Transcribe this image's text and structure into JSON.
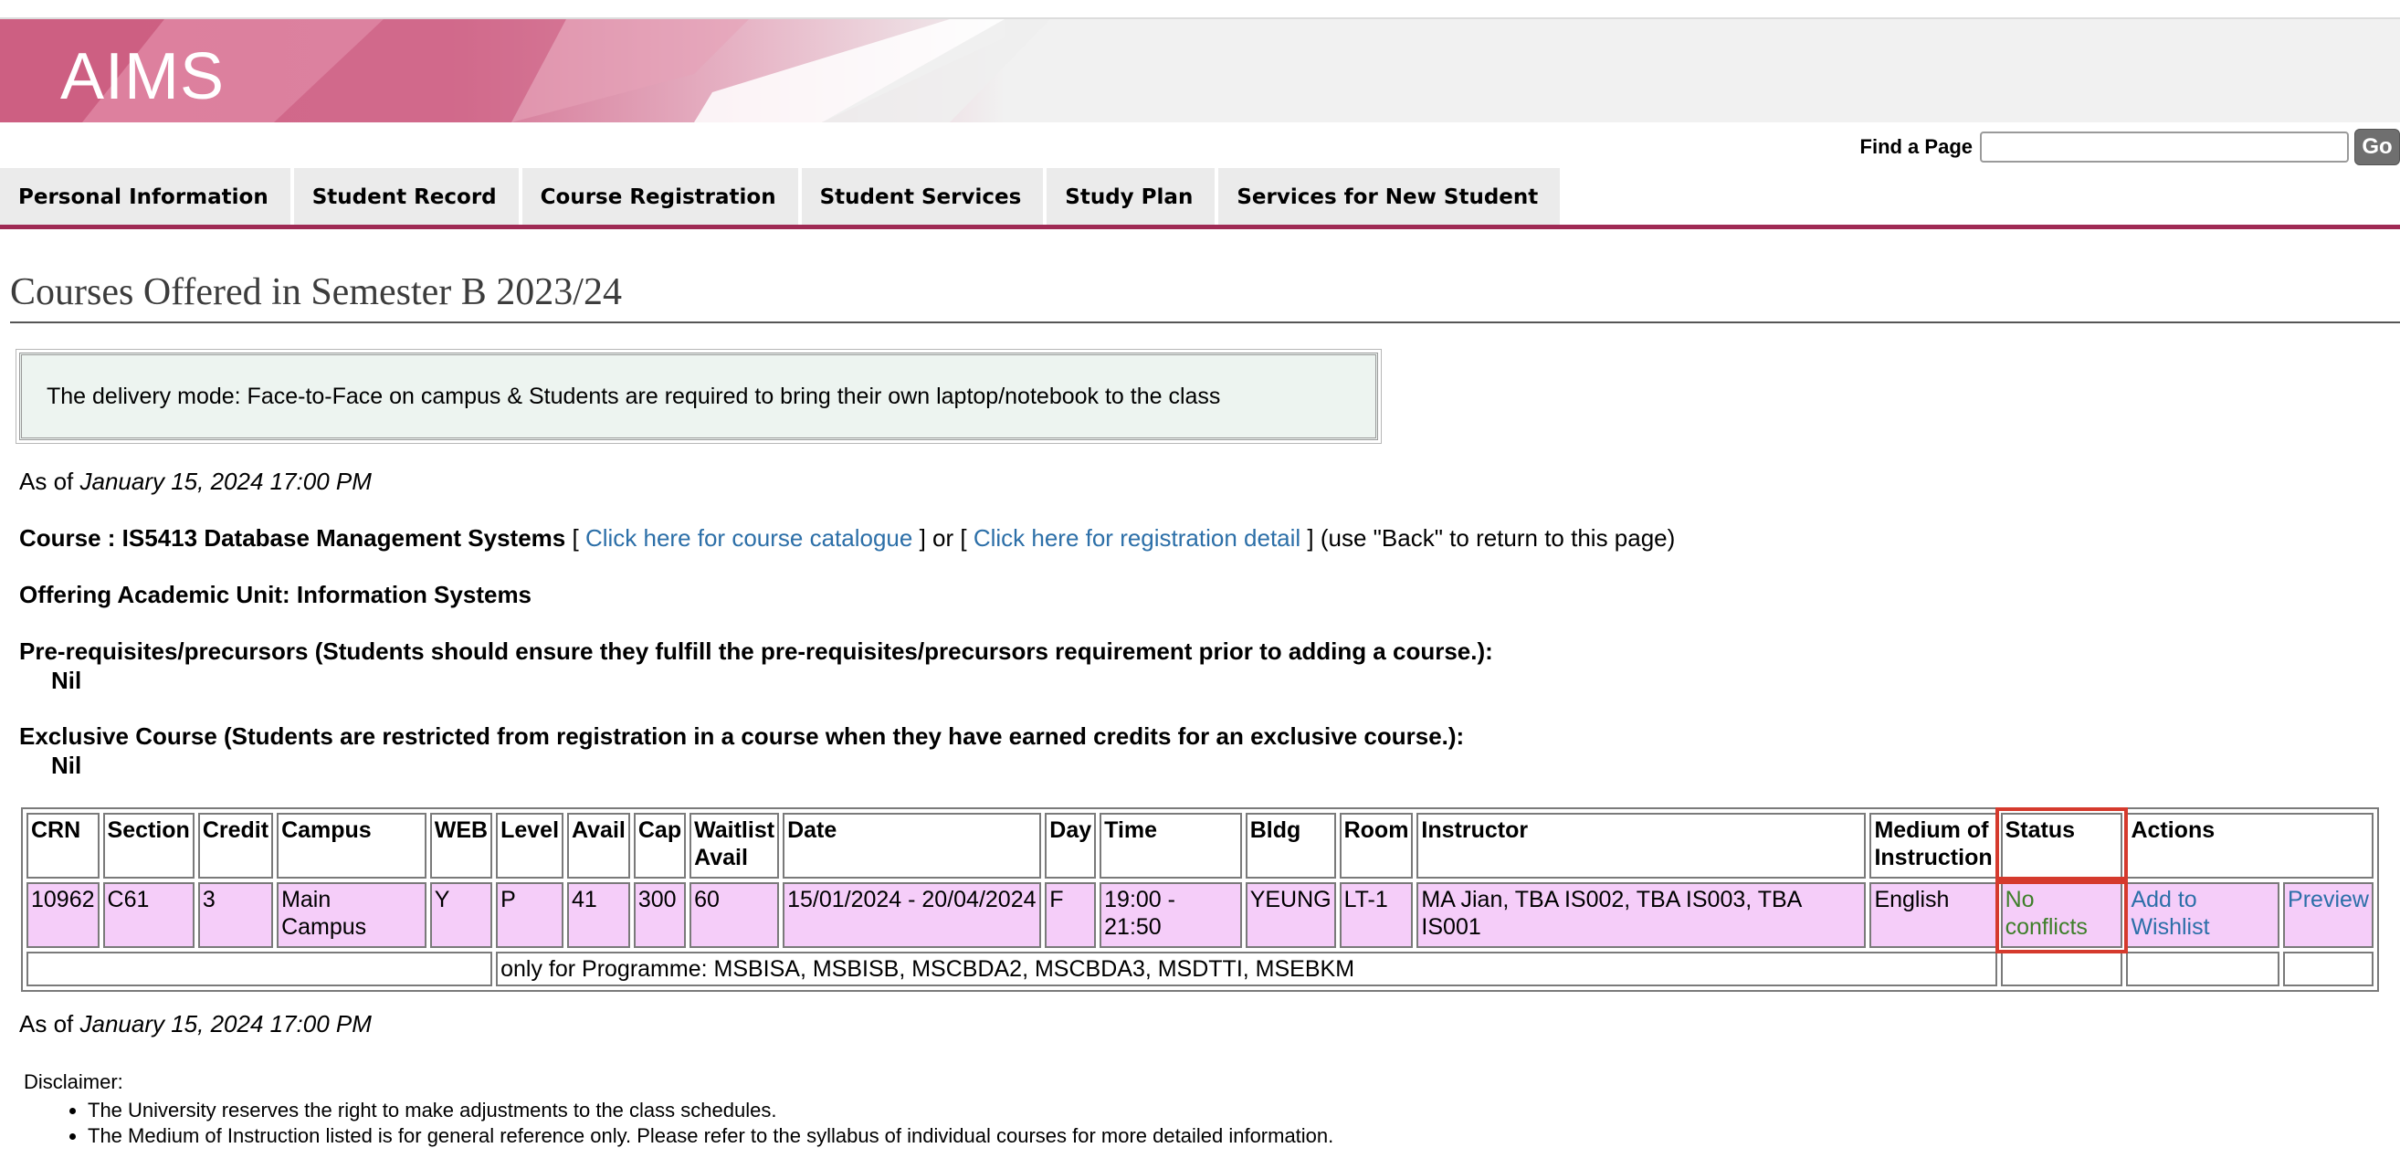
{
  "app": {
    "title": "AIMS"
  },
  "find_page": {
    "label": "Find a Page",
    "value": "",
    "button": "Go"
  },
  "nav": {
    "tabs": [
      "Personal Information",
      "Student Record",
      "Course Registration",
      "Student Services",
      "Study Plan",
      "Services for New Student"
    ]
  },
  "page": {
    "title": "Courses Offered in Semester B 2023/24",
    "notice": "The delivery mode: Face-to-Face on campus & Students are required to bring their own laptop/notebook to the class",
    "as_of_label": "As of",
    "as_of_value": "January 15, 2024 17:00 PM",
    "course_label": "Course : IS5413 Database Management Systems",
    "open_bracket": " [ ",
    "catalogue_link": "Click here for course catalogue",
    "or_text": " ] or [ ",
    "registration_link": "Click here for registration detail",
    "back_text": " ] (use \"Back\" to return to this page)",
    "academic_unit": "Offering Academic Unit: Information Systems",
    "prereq_label": "Pre-requisites/precursors (Students should ensure they fulfill the pre-requisites/precursors requirement prior to adding a course.):",
    "prereq_value": "Nil",
    "exclusive_label": "Exclusive Course (Students are restricted from registration in a course when they have earned credits for an exclusive course.):",
    "exclusive_value": "Nil"
  },
  "table": {
    "headers": [
      "CRN",
      "Section",
      "Credit",
      "Campus",
      "WEB",
      "Level",
      "Avail",
      "Cap",
      "Waitlist Avail",
      "Date",
      "Day",
      "Time",
      "Bldg",
      "Room",
      "Instructor",
      "Medium of Instruction",
      "Status",
      "Actions"
    ],
    "row": {
      "crn": "10962",
      "section": "C61",
      "credit": "3",
      "campus": "Main Campus",
      "web": "Y",
      "level": "P",
      "avail": "41",
      "cap": "300",
      "waitlist": "60",
      "date": "15/01/2024 - 20/04/2024",
      "day": "F",
      "time": "19:00 - 21:50",
      "bldg": "YEUNG",
      "room": "LT-1",
      "instructor": "MA Jian, TBA IS002, TBA IS003, TBA IS001",
      "medium": "English",
      "status": "No conflicts",
      "action_wishlist": "Add to Wishlist",
      "action_preview": "Preview"
    },
    "note": "only for Programme: MSBISA, MSBISB, MSCBDA2, MSCBDA3, MSDTTI, MSEBKM"
  },
  "footer": {
    "disclaimer_label": "Disclaimer:",
    "items": [
      "The University reserves the right to make adjustments to the class schedules.",
      "The Medium of Instruction listed is for general reference only. Please refer to the syllabus of individual courses for more detailed information."
    ]
  },
  "colors": {
    "accent": "#9f2a54",
    "row_highlight": "#f5cdf9",
    "link": "#2c6fa8",
    "status_ok": "#3e7f2a",
    "status_outline": "#d53a2d"
  }
}
